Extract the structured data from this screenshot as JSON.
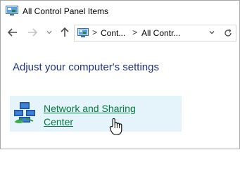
{
  "window": {
    "title": "All Control Panel Items",
    "icon": "control-panel-icon"
  },
  "nav": {
    "back_icon": "back-arrow-icon",
    "forward_icon": "forward-arrow-icon",
    "recent_icon": "chevron-down-icon",
    "up_icon": "up-arrow-icon",
    "address": {
      "crumbs": [
        "Cont...",
        "All Contr..."
      ],
      "separator": ">",
      "dropdown_icon": "chevron-down-icon",
      "refresh_icon": "refresh-icon"
    }
  },
  "main": {
    "heading": "Adjust your computer's settings",
    "items": [
      {
        "label_line1": "Network and Sharing",
        "label_line2": "Center",
        "icon": "network-icon",
        "state": "hover"
      }
    ]
  },
  "colors": {
    "heading": "#1e3287",
    "link": "#007a3d",
    "hover_bg": "#e5f3fb"
  }
}
